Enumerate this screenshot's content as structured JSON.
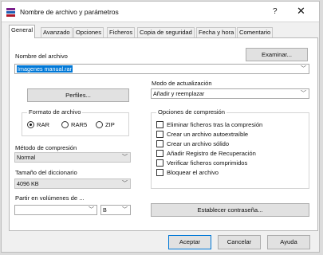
{
  "window": {
    "title": "Nombre de archivo y parámetros",
    "help_label": "?",
    "close_label": "✕"
  },
  "tabs": [
    {
      "label": "General"
    },
    {
      "label": "Avanzado"
    },
    {
      "label": "Opciones"
    },
    {
      "label": "Ficheros"
    },
    {
      "label": "Copia de seguridad"
    },
    {
      "label": "Fecha y hora"
    },
    {
      "label": "Comentario"
    }
  ],
  "general": {
    "archive_name_label": "Nombre del archivo",
    "browse_label": "Examinar...",
    "archive_name_value": "Imagenes manual.rar",
    "profiles_label": "Perfiles...",
    "update_mode_label": "Modo de actualización",
    "update_mode_value": "Añadir y reemplazar",
    "format_group_title": "Formato de archivo",
    "format_options": [
      "RAR",
      "RAR5",
      "ZIP"
    ],
    "format_selected": "RAR",
    "compression_method_label": "Método de compresión",
    "compression_method_value": "Normal",
    "dictionary_size_label": "Tamaño del diccionario",
    "dictionary_size_value": "4096 KB",
    "split_label": "Partir en volúmenes de ...",
    "split_value": "",
    "split_unit_value": "B",
    "options_group_title": "Opciones de compresión",
    "options": [
      {
        "label": "Eliminar ficheros tras la compresión",
        "checked": false
      },
      {
        "label": "Crear un archivo autoextraíble",
        "checked": false
      },
      {
        "label": "Crear un archivo sólido",
        "checked": false
      },
      {
        "label": "Añadir Registro de Recuperación",
        "checked": false
      },
      {
        "label": "Verificar ficheros comprimidos",
        "checked": false
      },
      {
        "label": "Bloquear el archivo",
        "checked": false
      }
    ],
    "set_password_label": "Establecer contraseña..."
  },
  "footer": {
    "ok_label": "Aceptar",
    "cancel_label": "Cancelar",
    "help_label": "Ayuda"
  },
  "colors": {
    "accent": "#0078d7",
    "window_bg": "#f0f0f0",
    "panel_bg": "#ffffff"
  },
  "icons": {
    "app": "winrar-books-icon",
    "dropdown": "chevron-down-icon"
  }
}
